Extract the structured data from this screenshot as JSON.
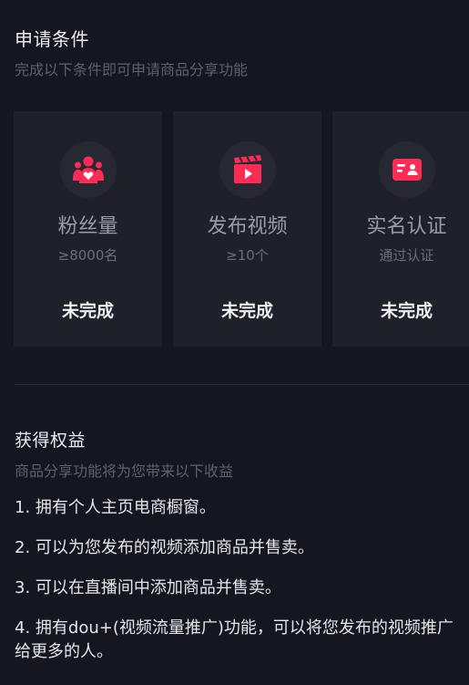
{
  "conditions": {
    "title": "申请条件",
    "subtitle": "完成以下条件即可申请商品分享功能",
    "cards": [
      {
        "icon": "fans-icon",
        "name": "粉丝量",
        "requirement": "≥8000名",
        "status": "未完成"
      },
      {
        "icon": "video-icon",
        "name": "发布视频",
        "requirement": "≥10个",
        "status": "未完成"
      },
      {
        "icon": "id-card-icon",
        "name": "实名认证",
        "requirement": "通过认证",
        "status": "未完成"
      }
    ]
  },
  "benefits": {
    "title": "获得权益",
    "subtitle": "商品分享功能将为您带来以下收益",
    "items": [
      "1. 拥有个人主页电商橱窗。",
      "2. 可以为您发布的视频添加商品并售卖。",
      "3. 可以在直播间中添加商品并售卖。",
      "4. 拥有dou+(视频流量推广)功能，可以将您发布的视频推广给更多的人。"
    ]
  },
  "colors": {
    "background": "#15161f",
    "card": "#1f2029",
    "accent": "#fe2c55"
  }
}
